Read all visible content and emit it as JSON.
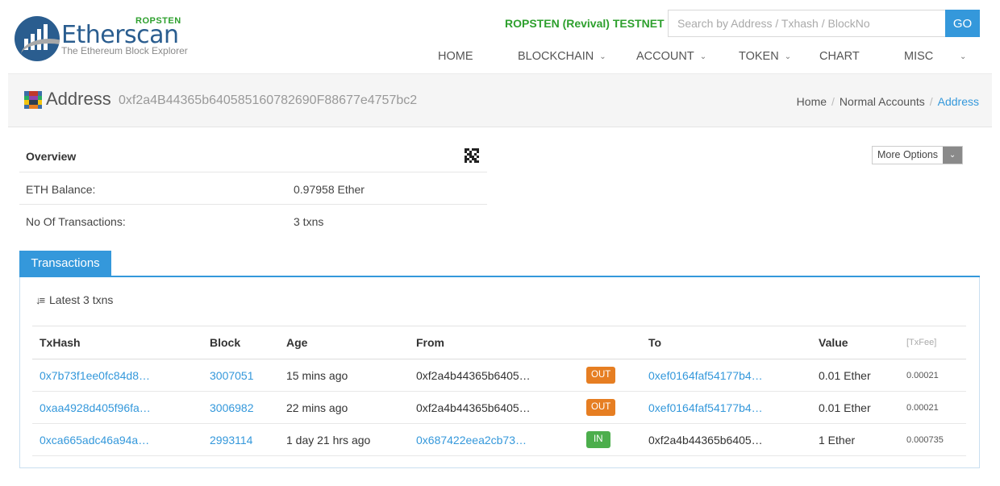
{
  "header": {
    "logo_badge": "ROPSTEN",
    "logo_name": "Etherscan",
    "logo_tagline": "The Ethereum Block Explorer",
    "network": "ROPSTEN (Revival) TESTNET",
    "search_placeholder": "Search by Address / Txhash / BlockNo",
    "go_label": "GO"
  },
  "nav": [
    {
      "label": "HOME"
    },
    {
      "label": "BLOCKCHAIN"
    },
    {
      "label": "ACCOUNT"
    },
    {
      "label": "TOKEN"
    },
    {
      "label": "CHART"
    },
    {
      "label": "MISC"
    }
  ],
  "page": {
    "title": "Address",
    "address": "0xf2a4B44365b640585160782690F88677e4757bc2",
    "breadcrumb": [
      "Home",
      "Normal Accounts",
      "Address"
    ]
  },
  "overview": {
    "title": "Overview",
    "rows": [
      {
        "label": "ETH Balance:",
        "value": "0.97958 Ether"
      },
      {
        "label": "No Of Transactions:",
        "value": "3 txns"
      }
    ],
    "more_options": "More Options"
  },
  "transactions": {
    "tab_label": "Transactions",
    "latest_label": "Latest 3 txns",
    "columns": [
      "TxHash",
      "Block",
      "Age",
      "From",
      "",
      "To",
      "Value",
      "[TxFee]"
    ],
    "rows": [
      {
        "txhash": "0x7b73f1ee0fc84d8…",
        "block": "3007051",
        "age": "15 mins ago",
        "from": "0xf2a4b44365b6405…",
        "direction": "OUT",
        "to": "0xef0164faf54177b4…",
        "value": "0.01 Ether",
        "fee": "0.00021"
      },
      {
        "txhash": "0xaa4928d405f96fa…",
        "block": "3006982",
        "age": "22 mins ago",
        "from": "0xf2a4b44365b6405…",
        "direction": "OUT",
        "to": "0xef0164faf54177b4…",
        "value": "0.01 Ether",
        "fee": "0.00021"
      },
      {
        "txhash": "0xca665adc46a94a…",
        "block": "2993114",
        "age": "1 day 21 hrs ago",
        "from": "0x687422eea2cb73…",
        "direction": "IN",
        "to": "0xf2a4b44365b6405…",
        "value": "1 Ether",
        "fee": "0.000735"
      }
    ]
  },
  "colors": {
    "accent": "#3498db",
    "testnet_green": "#2ea02e",
    "out_badge": "#e67e22",
    "in_badge": "#4cae4c"
  }
}
